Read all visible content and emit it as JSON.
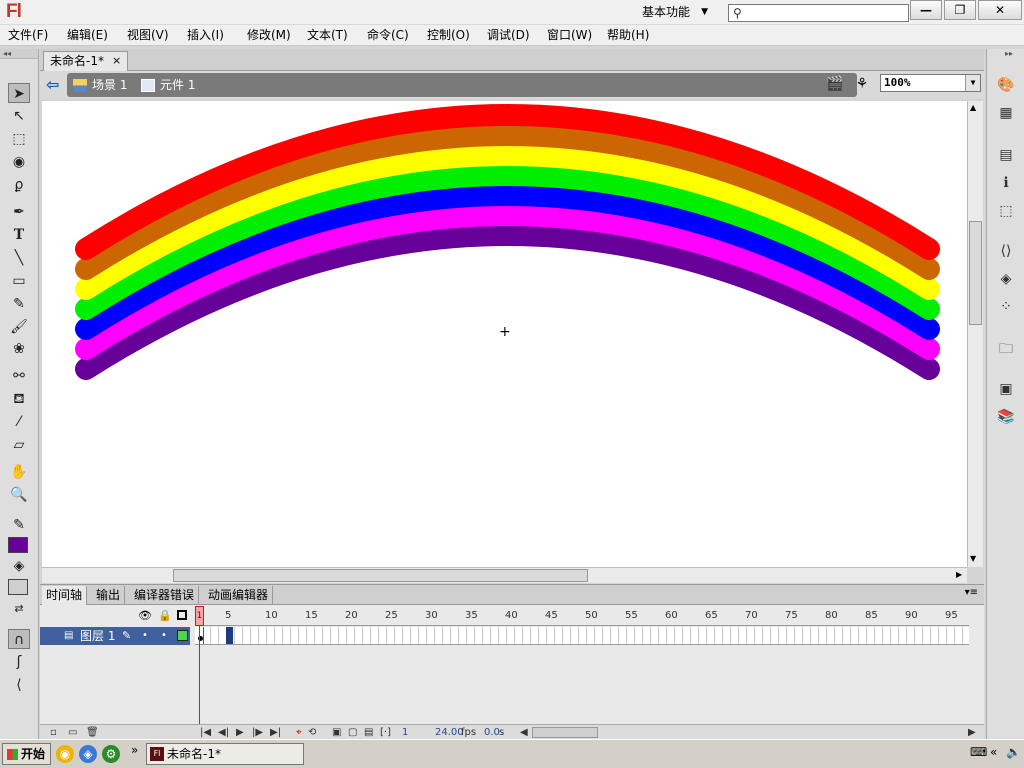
{
  "app": {
    "logo": "Fl",
    "workspace": "基本功能",
    "search_placeholder": ""
  },
  "window_controls": {
    "minimize": "—",
    "restore": "❐",
    "close": "✕"
  },
  "menu": [
    {
      "label": "文件(F)"
    },
    {
      "label": "编辑(E)"
    },
    {
      "label": "视图(V)"
    },
    {
      "label": "插入(I)"
    },
    {
      "label": "修改(M)"
    },
    {
      "label": "文本(T)"
    },
    {
      "label": "命令(C)"
    },
    {
      "label": "控制(O)"
    },
    {
      "label": "调试(D)"
    },
    {
      "label": "窗口(W)"
    },
    {
      "label": "帮助(H)"
    }
  ],
  "document": {
    "tab_title": "未命名-1*",
    "tab_close": "×"
  },
  "breadcrumb": {
    "scene": "场景 1",
    "symbol": "元件 1"
  },
  "zoom": {
    "value": "100%"
  },
  "stage": {
    "rainbow_colors": [
      "#ff0000",
      "#cc6600",
      "#ffff00",
      "#00ee00",
      "#0000ff",
      "#ff00ff",
      "#660099"
    ]
  },
  "tools": {
    "stroke_color": "#660099",
    "fill_color": "#cfcfcf",
    "icons": [
      "selection-tool-icon",
      "subselection-tool-icon",
      "free-transform-icon",
      "3d-rotation-icon",
      "lasso-icon",
      "pen-icon",
      "text-icon",
      "line-icon",
      "rectangle-icon",
      "pencil-icon",
      "brush-icon",
      "deco-icon",
      "bone-icon",
      "paint-bucket-icon",
      "eyedropper-icon",
      "eraser-icon",
      "hand-icon",
      "zoom-icon"
    ]
  },
  "timeline": {
    "tabs": [
      "时间轴",
      "输出",
      "编译器错误",
      "动画编辑器"
    ],
    "layer_name": "图层 1",
    "frame_numbers": [
      "5",
      "10",
      "15",
      "20",
      "25",
      "30",
      "35",
      "40",
      "45",
      "50",
      "55",
      "60",
      "65",
      "70",
      "75",
      "80",
      "85",
      "90",
      "95"
    ],
    "current_frame": "1",
    "fps": "24.00",
    "fps_unit": "fps",
    "time": "0.0",
    "time_unit": "s"
  },
  "taskbar": {
    "start": "开始",
    "task_title": "未命名-1*",
    "more": "»"
  }
}
